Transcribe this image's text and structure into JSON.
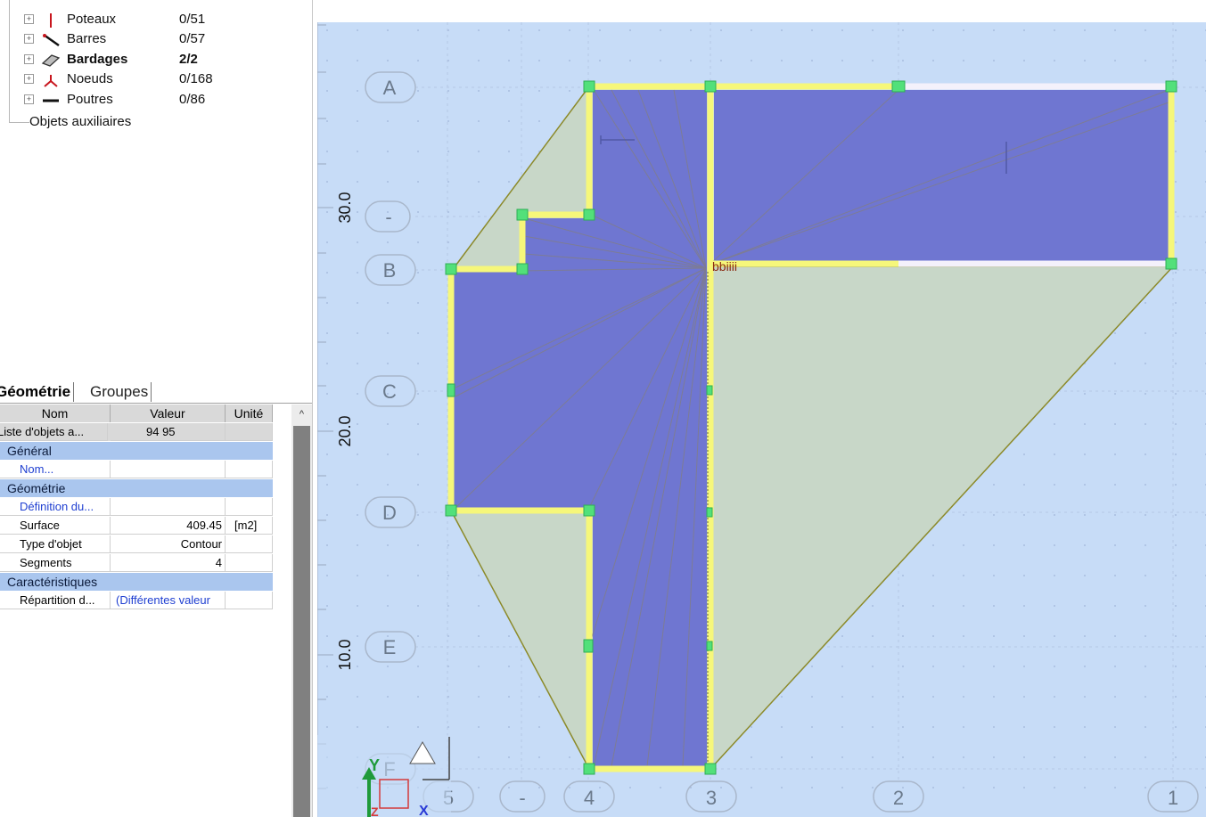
{
  "tree": {
    "items": [
      {
        "label": "Poteaux",
        "count": "0/51",
        "icon": "column-icon",
        "bold": false
      },
      {
        "label": "Barres",
        "count": "0/57",
        "icon": "bar-icon",
        "bold": false
      },
      {
        "label": "Bardages",
        "count": "2/2",
        "icon": "cladding-icon",
        "bold": true
      },
      {
        "label": "Noeuds",
        "count": "0/168",
        "icon": "node-icon",
        "bold": false
      },
      {
        "label": "Poutres",
        "count": "0/86",
        "icon": "beam-icon",
        "bold": false
      }
    ],
    "aux_label": "Objets auxiliaires"
  },
  "props": {
    "tabs": [
      "Géométrie",
      "Groupes"
    ],
    "columns": [
      "Nom",
      "Valeur",
      "Unité"
    ],
    "list_row": {
      "name": "Liste d'objets a...",
      "value": "94 95",
      "unit": ""
    },
    "sections": [
      {
        "title": "Général",
        "rows": [
          {
            "name": "Nom...",
            "value": "",
            "unit": "",
            "link": true
          }
        ]
      },
      {
        "title": "Géométrie",
        "rows": [
          {
            "name": "Définition du...",
            "value": "",
            "unit": "",
            "link": true
          },
          {
            "name": "Surface",
            "value": "409.45",
            "unit": "[m2]",
            "link": false
          },
          {
            "name": "Type d'objet",
            "value": "Contour",
            "unit": "",
            "link": false
          },
          {
            "name": "Segments",
            "value": "4",
            "unit": "",
            "link": false
          }
        ]
      },
      {
        "title": "Caractéristiques",
        "rows": [
          {
            "name": "Répartition d...",
            "value": "(Différentes valeur",
            "unit": "",
            "link": false,
            "value_link": true
          }
        ]
      }
    ]
  },
  "canvas": {
    "row_axes": [
      "A",
      "-",
      "B",
      "C",
      "D",
      "E",
      "F"
    ],
    "col_axes": [
      "5",
      "-",
      "4",
      "3",
      "2",
      "1"
    ],
    "dim_labels": [
      "30.0",
      "20.0",
      "10.0"
    ],
    "node_label": "bbiiii",
    "axis_y": "Y",
    "axis_x": "X",
    "axis_z": "Z",
    "colors": {
      "background": "#c7dcf7",
      "panel_fill": "#6f76d1",
      "tributary_fill": "#c8d7c8",
      "beam": "#f6f77a",
      "node": "#52e07a",
      "outline": "#8c8a2a"
    }
  }
}
